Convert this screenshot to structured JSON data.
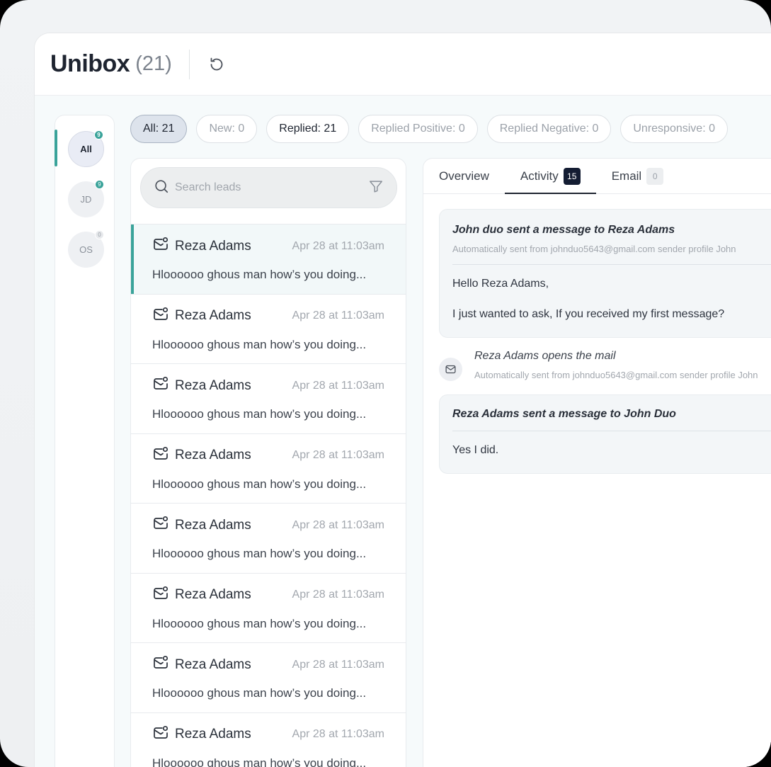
{
  "header": {
    "title": "Unibox",
    "count": "(21)"
  },
  "accounts": [
    {
      "label": "All",
      "badge": "9"
    },
    {
      "label": "JD",
      "badge": "9"
    },
    {
      "label": "OS",
      "badge": "0"
    }
  ],
  "filters": [
    {
      "label": "All: 21"
    },
    {
      "label": "New: 0"
    },
    {
      "label": "Replied: 21"
    },
    {
      "label": "Replied Positive: 0"
    },
    {
      "label": "Replied Negative: 0"
    },
    {
      "label": "Unresponsive: 0"
    }
  ],
  "search": {
    "placeholder": "Search leads"
  },
  "leads": [
    {
      "name": "Reza Adams",
      "date": "Apr 28 at 11:03am",
      "preview": "Hloooooo ghous man how’s you doing..."
    },
    {
      "name": "Reza Adams",
      "date": "Apr 28 at 11:03am",
      "preview": "Hloooooo ghous man how’s you doing..."
    },
    {
      "name": "Reza Adams",
      "date": "Apr 28 at 11:03am",
      "preview": "Hloooooo ghous man how’s you doing..."
    },
    {
      "name": "Reza Adams",
      "date": "Apr 28 at 11:03am",
      "preview": "Hloooooo ghous man how’s you doing..."
    },
    {
      "name": "Reza Adams",
      "date": "Apr 28 at 11:03am",
      "preview": "Hloooooo ghous man how’s you doing..."
    },
    {
      "name": "Reza Adams",
      "date": "Apr 28 at 11:03am",
      "preview": "Hloooooo ghous man how’s you doing..."
    },
    {
      "name": "Reza Adams",
      "date": "Apr 28 at 11:03am",
      "preview": "Hloooooo ghous man how’s you doing..."
    },
    {
      "name": "Reza Adams",
      "date": "Apr 28 at 11:03am",
      "preview": "Hloooooo ghous man how’s you doing..."
    }
  ],
  "tabs": [
    {
      "label": "Overview"
    },
    {
      "label": "Activity",
      "badge": "15"
    },
    {
      "label": "Email",
      "badge": "0"
    }
  ],
  "activity": {
    "message1": {
      "title": "John duo sent a message to Reza Adams",
      "sub": "Automatically sent from johnduo5643@gmail.com sender profile John",
      "line1": "Hello Reza Adams,",
      "line2": "I just wanted to ask, If you received my first message?"
    },
    "event1": {
      "title": "Reza Adams opens the mail",
      "sub": "Automatically sent from johnduo5643@gmail.com sender profile John"
    },
    "message2": {
      "title": "Reza Adams sent a message to John Duo",
      "line1": "Yes I did."
    }
  },
  "colors": {
    "accent": "#3aa39a",
    "dark_badge": "#141d33"
  }
}
